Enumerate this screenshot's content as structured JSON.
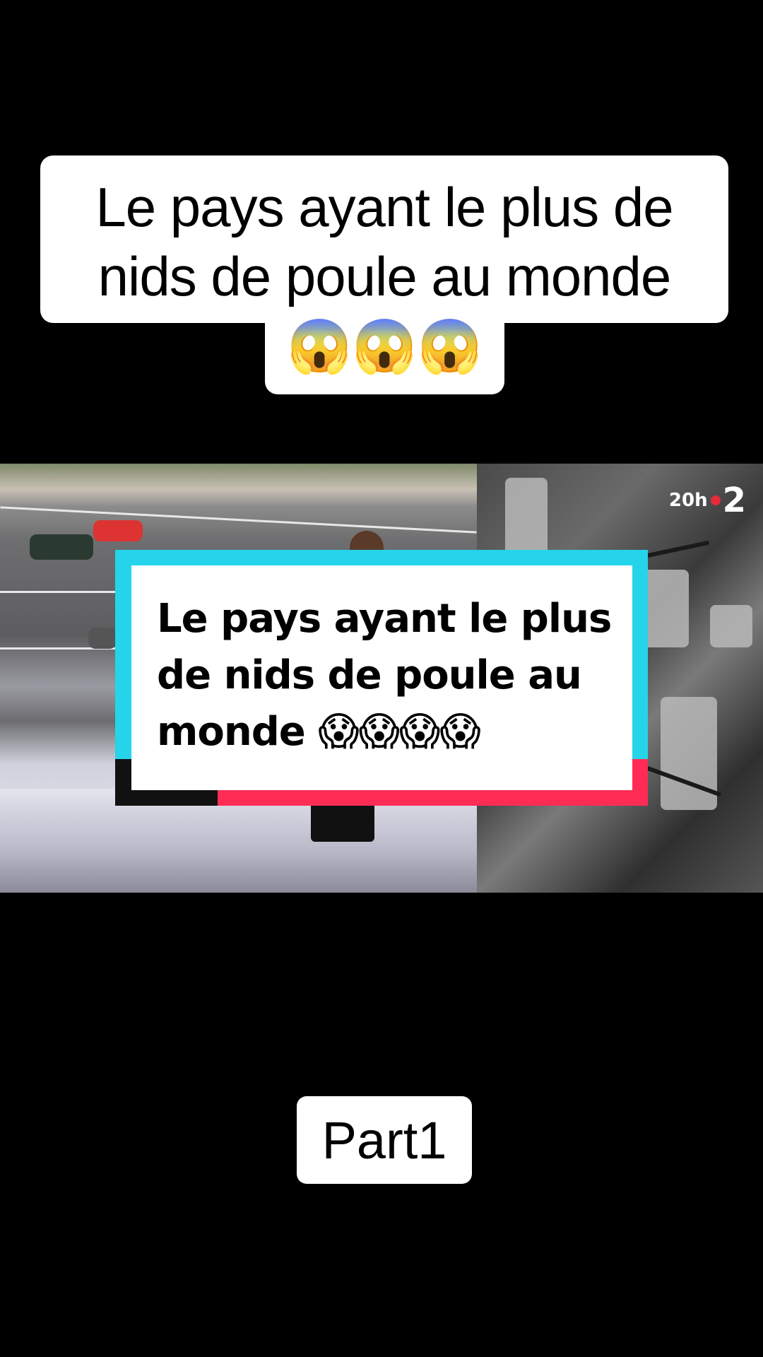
{
  "caption_top": {
    "text": "Le pays ayant le plus de nids de poule au monde",
    "emoji": "😱😱😱"
  },
  "video": {
    "channel_logo": {
      "time": "20h",
      "channel": "2"
    },
    "overlay_card": {
      "text": "Le pays ayant le plus de nids de poule au monde 😱😱😱😱"
    }
  },
  "part_label": "Part1",
  "colors": {
    "card_frame": "#25d4ea",
    "card_accent_red": "#fe2c55",
    "logo_dot": "#e52b3a"
  }
}
